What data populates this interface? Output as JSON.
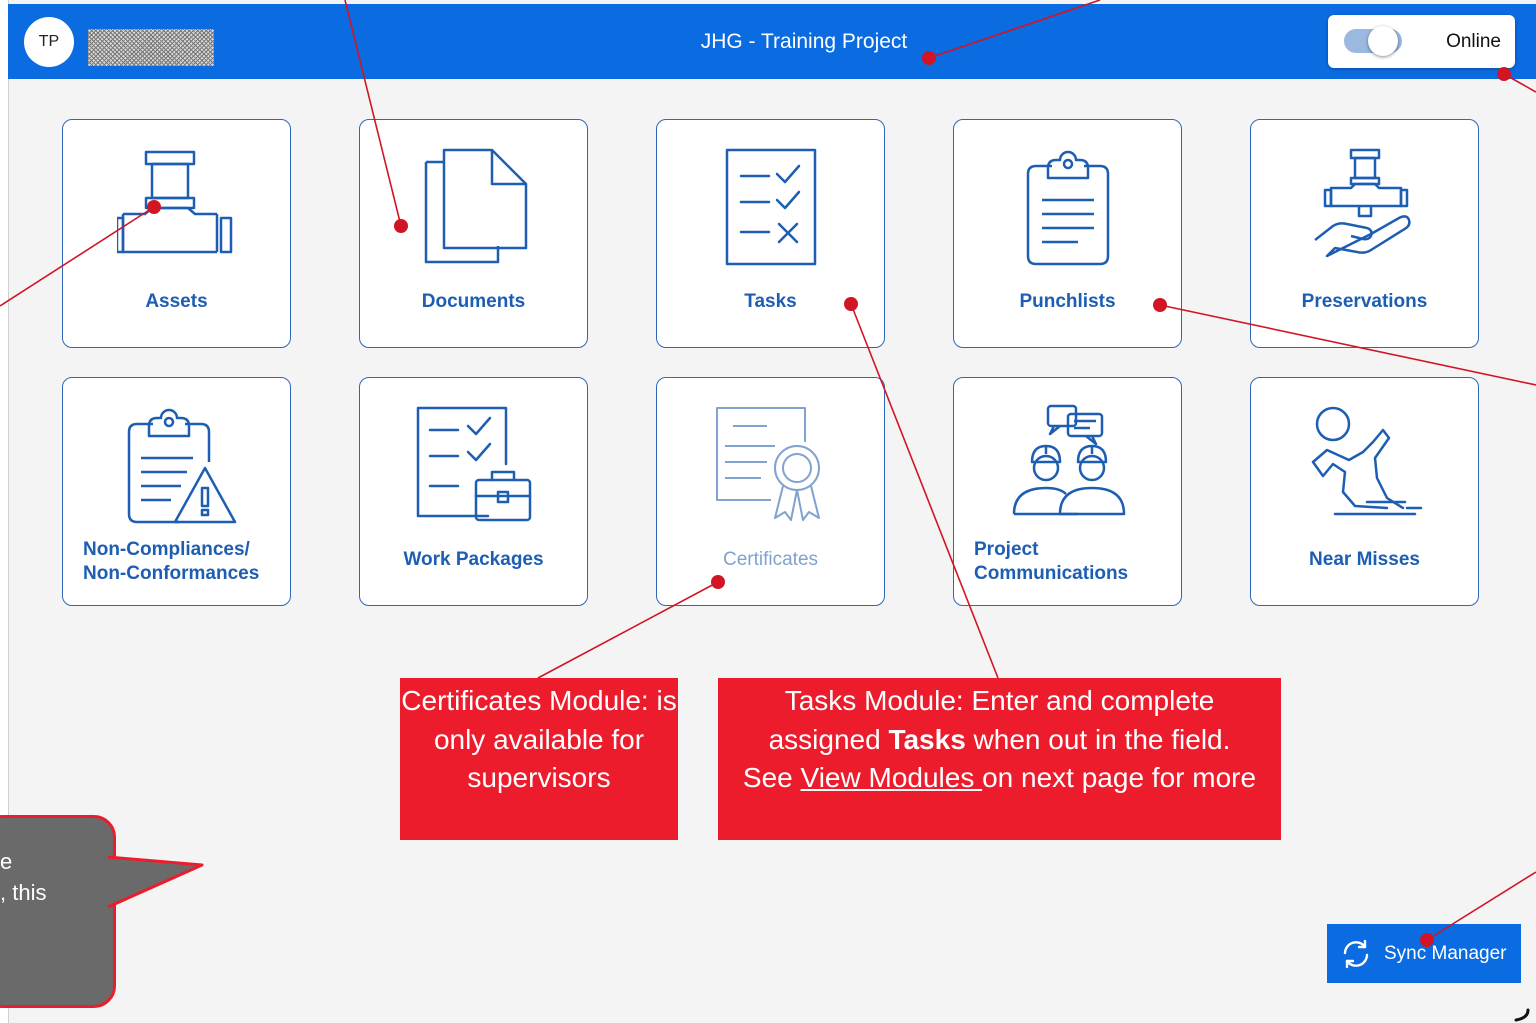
{
  "header": {
    "avatar_initials": "TP",
    "project_title": "JHG - Training Project",
    "status_label": "Online"
  },
  "modules": [
    {
      "label": "Assets",
      "icon": "pipe-fitting-icon",
      "enabled": true
    },
    {
      "label": "Documents",
      "icon": "documents-icon",
      "enabled": true
    },
    {
      "label": "Tasks",
      "icon": "checklist-icon",
      "enabled": true
    },
    {
      "label": "Punchlists",
      "icon": "clipboard-icon",
      "enabled": true
    },
    {
      "label": "Preservations",
      "icon": "hand-pipe-icon",
      "enabled": true
    },
    {
      "label": "Non-Compliances/ Non-Conformances",
      "icon": "clipboard-warning-icon",
      "enabled": true
    },
    {
      "label": "Work Packages",
      "icon": "checklist-briefcase-icon",
      "enabled": true
    },
    {
      "label": "Certificates",
      "icon": "certificate-icon",
      "enabled": false
    },
    {
      "label": "Project Communications",
      "icon": "workers-chat-icon",
      "enabled": true
    },
    {
      "label": "Near Misses",
      "icon": "slip-fall-icon",
      "enabled": true
    }
  ],
  "callouts": {
    "certificates": "Certificates Module: is only available for supervisors",
    "tasks_pre": "Tasks Module: Enter and complete assigned ",
    "tasks_bold": "Tasks",
    "tasks_mid": " when out in the field. See ",
    "tasks_link": "View Modules ",
    "tasks_post": "on next page for more",
    "speech_fragment_1": "e",
    "speech_fragment_2": ", this"
  },
  "sync": {
    "label": "Sync Manager",
    "icon": "sync-icon"
  },
  "colors": {
    "brand_blue": "#0b6be0",
    "tile_blue": "#1d5eb3",
    "callout_red": "#ec1c2d"
  }
}
